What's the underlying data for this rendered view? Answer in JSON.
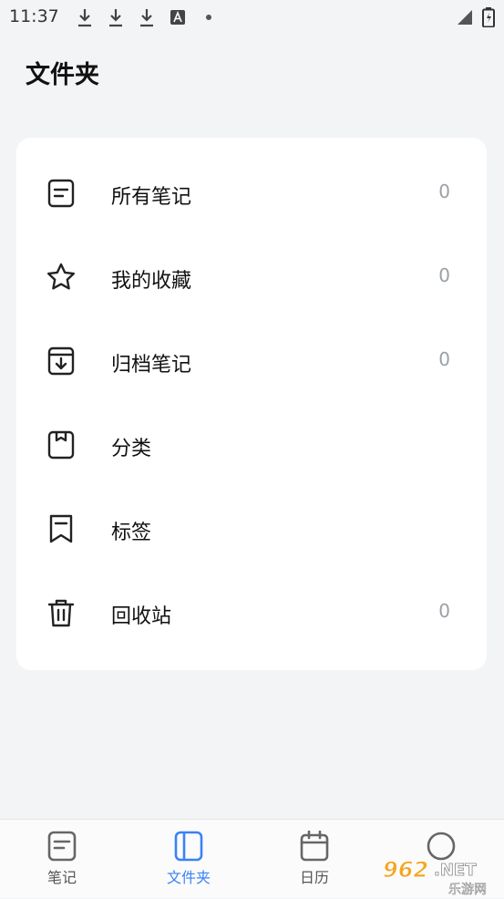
{
  "status_bar": {
    "time": "11:37",
    "icons": [
      "download-icon",
      "download-icon",
      "download-icon",
      "font-a-icon",
      "dot-icon",
      "signal-icon",
      "battery-icon"
    ]
  },
  "page": {
    "title": "文件夹"
  },
  "folders": [
    {
      "label": "所有笔记",
      "count": "0",
      "icon": "note-icon"
    },
    {
      "label": "我的收藏",
      "count": "0",
      "icon": "star-icon"
    },
    {
      "label": "归档笔记",
      "count": "0",
      "icon": "archive-icon"
    },
    {
      "label": "分类",
      "count": "",
      "icon": "category-icon"
    },
    {
      "label": "标签",
      "count": "",
      "icon": "tag-icon"
    },
    {
      "label": "回收站",
      "count": "0",
      "icon": "trash-icon"
    }
  ],
  "bottom_nav": {
    "items": [
      {
        "label": "笔记",
        "icon": "notes-icon",
        "active": false
      },
      {
        "label": "文件夹",
        "icon": "folder-icon",
        "active": true
      },
      {
        "label": "日历",
        "icon": "calendar-icon",
        "active": false
      },
      {
        "label": "",
        "icon": "profile-icon",
        "active": false
      }
    ]
  },
  "watermark": {
    "text": "962.NET",
    "subtext": "乐游网"
  },
  "colors": {
    "accent": "#3b82f6",
    "text": "#111111",
    "muted": "#9aa0a6",
    "background": "#f3f4f6",
    "card": "#ffffff"
  }
}
